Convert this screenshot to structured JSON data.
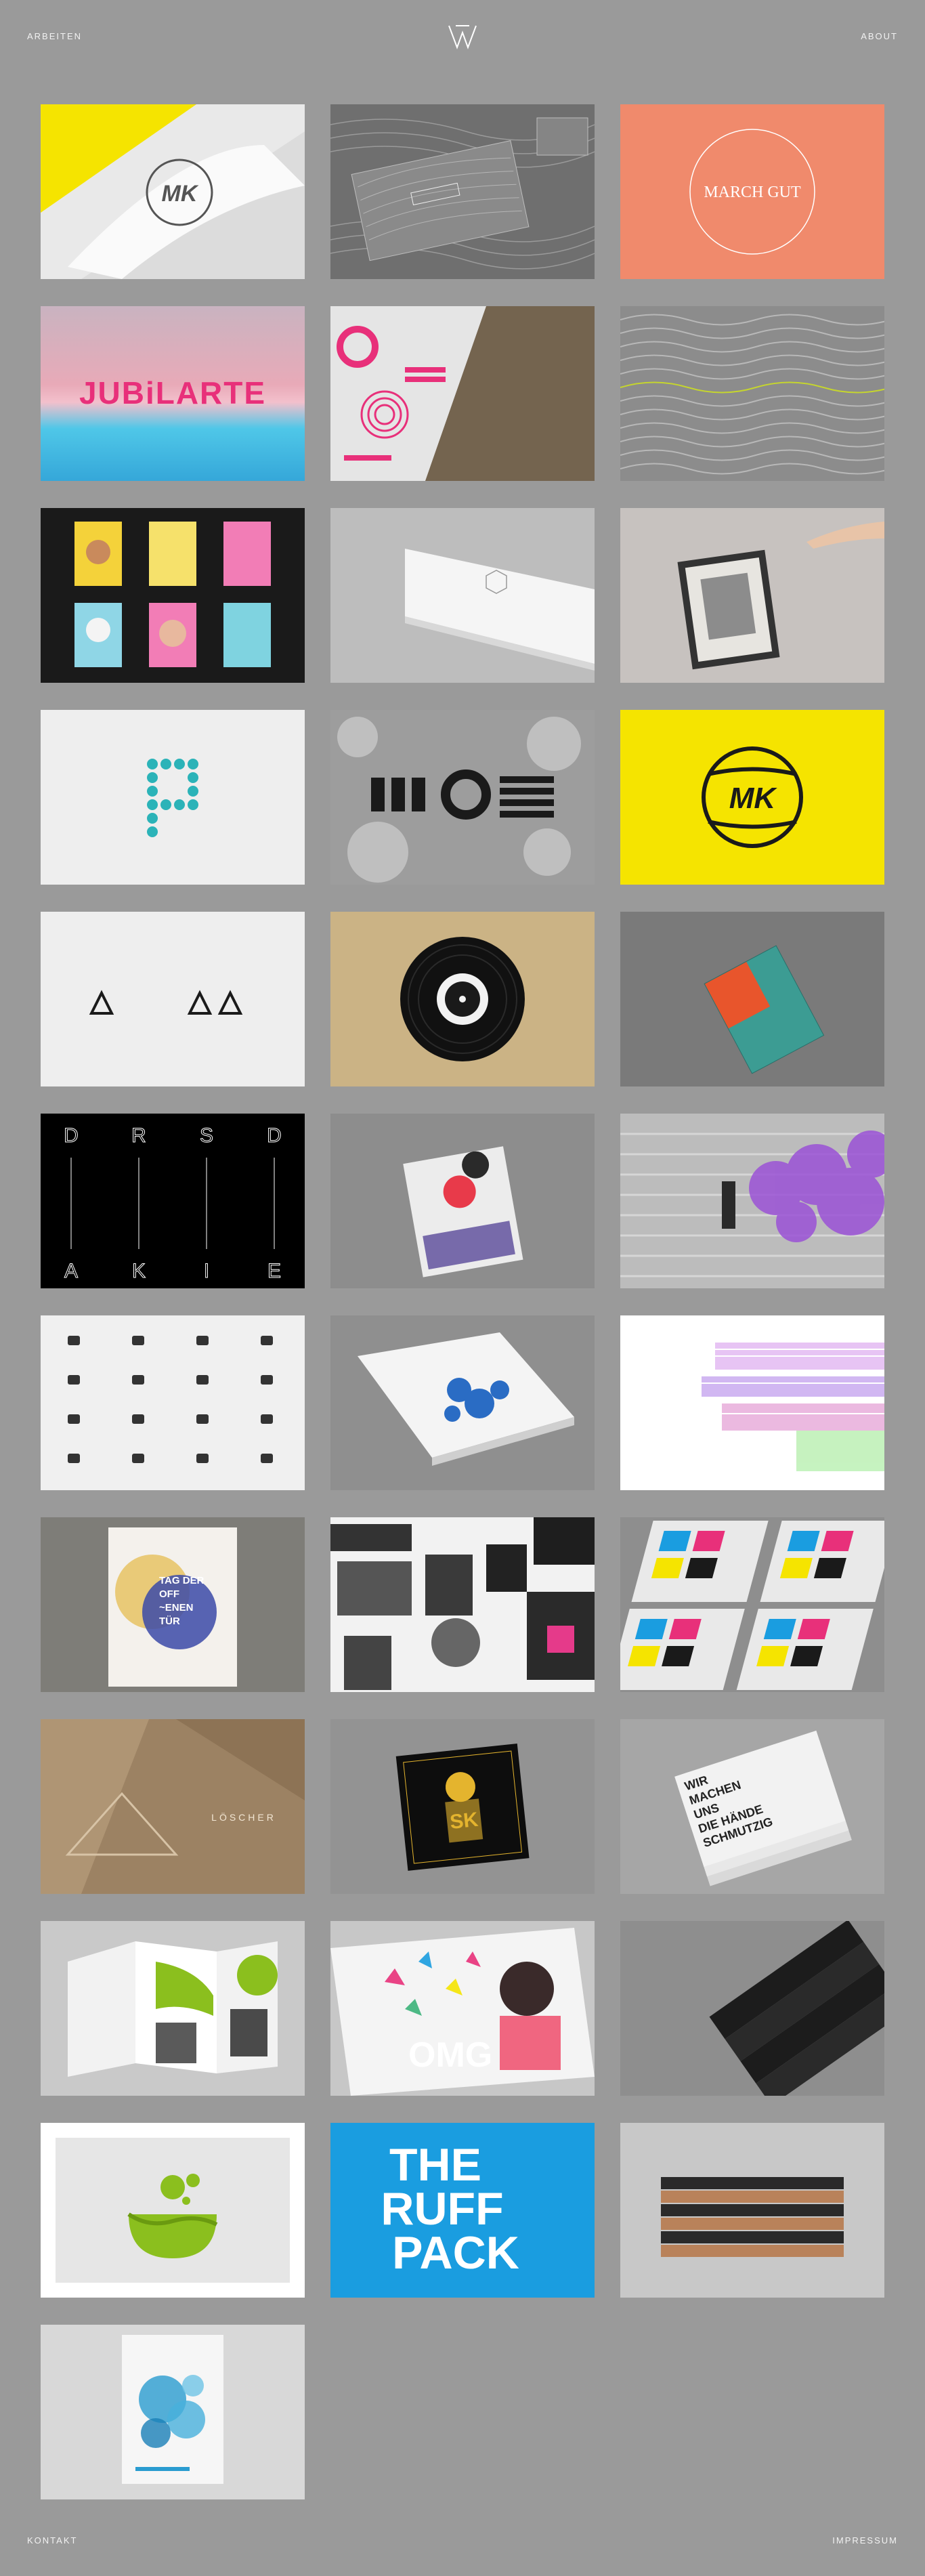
{
  "header": {
    "left_link": "ARBEITEN",
    "right_link": "ABOUT"
  },
  "footer": {
    "left_link": "KONTAKT",
    "right_link": "IMPRESSUM"
  },
  "tiles": [
    {
      "id": "mk-paper",
      "text": "MK"
    },
    {
      "id": "contour-cards",
      "text": ""
    },
    {
      "id": "march-gut",
      "text": "MARCH GUT"
    },
    {
      "id": "jubilarte",
      "text": "JUBiLARTE"
    },
    {
      "id": "pink-print",
      "text": ""
    },
    {
      "id": "wave-lines",
      "text": ""
    },
    {
      "id": "poster-wall",
      "text": ""
    },
    {
      "id": "white-box",
      "text": ""
    },
    {
      "id": "frame-hand",
      "text": ""
    },
    {
      "id": "dotted-p",
      "text": ""
    },
    {
      "id": "ground-logo",
      "text": ""
    },
    {
      "id": "mk-yellow",
      "text": "MK"
    },
    {
      "id": "triangles",
      "text": ""
    },
    {
      "id": "vinyl",
      "text": ""
    },
    {
      "id": "tag-der-book",
      "text": ""
    },
    {
      "id": "drsd",
      "letters": [
        "D",
        "R",
        "S",
        "D",
        "A",
        "K",
        "I",
        "E"
      ]
    },
    {
      "id": "abstract-cards",
      "text": ""
    },
    {
      "id": "purple-smoke",
      "text": ""
    },
    {
      "id": "icon-grid",
      "text": ""
    },
    {
      "id": "erstmals-book",
      "text": ""
    },
    {
      "id": "glitch-art",
      "text": ""
    },
    {
      "id": "tag-der-poster",
      "lines": [
        "TAG DER",
        "OFF",
        "~ENEN",
        "TÜR"
      ]
    },
    {
      "id": "photo-collage",
      "text": ""
    },
    {
      "id": "cmyk-cards",
      "text": ""
    },
    {
      "id": "loscher",
      "text": "LÖSCHER"
    },
    {
      "id": "sk-cd",
      "text": "SK"
    },
    {
      "id": "magazine-stack",
      "lines": [
        "WIR",
        "MACHEN",
        "UNS",
        "DIE HÄNDE",
        "SCHMUTZIG"
      ]
    },
    {
      "id": "brochure",
      "text": ""
    },
    {
      "id": "omg",
      "text": "OMG"
    },
    {
      "id": "black-cards",
      "text": ""
    },
    {
      "id": "green-bowl",
      "text": ""
    },
    {
      "id": "ruff-pack",
      "lines": [
        "THE",
        "RUFF",
        "PACK"
      ]
    },
    {
      "id": "book-stack",
      "text": ""
    },
    {
      "id": "circle-poster",
      "text": ""
    }
  ],
  "colors": {
    "background": "#9a9a9a",
    "yellow": "#f5e400",
    "salmon": "#f08a6c",
    "pink": "#e8307a",
    "teal": "#2bb3b8",
    "blue": "#1a9de0",
    "green": "#8bbf1e",
    "tan": "#cbb385"
  }
}
